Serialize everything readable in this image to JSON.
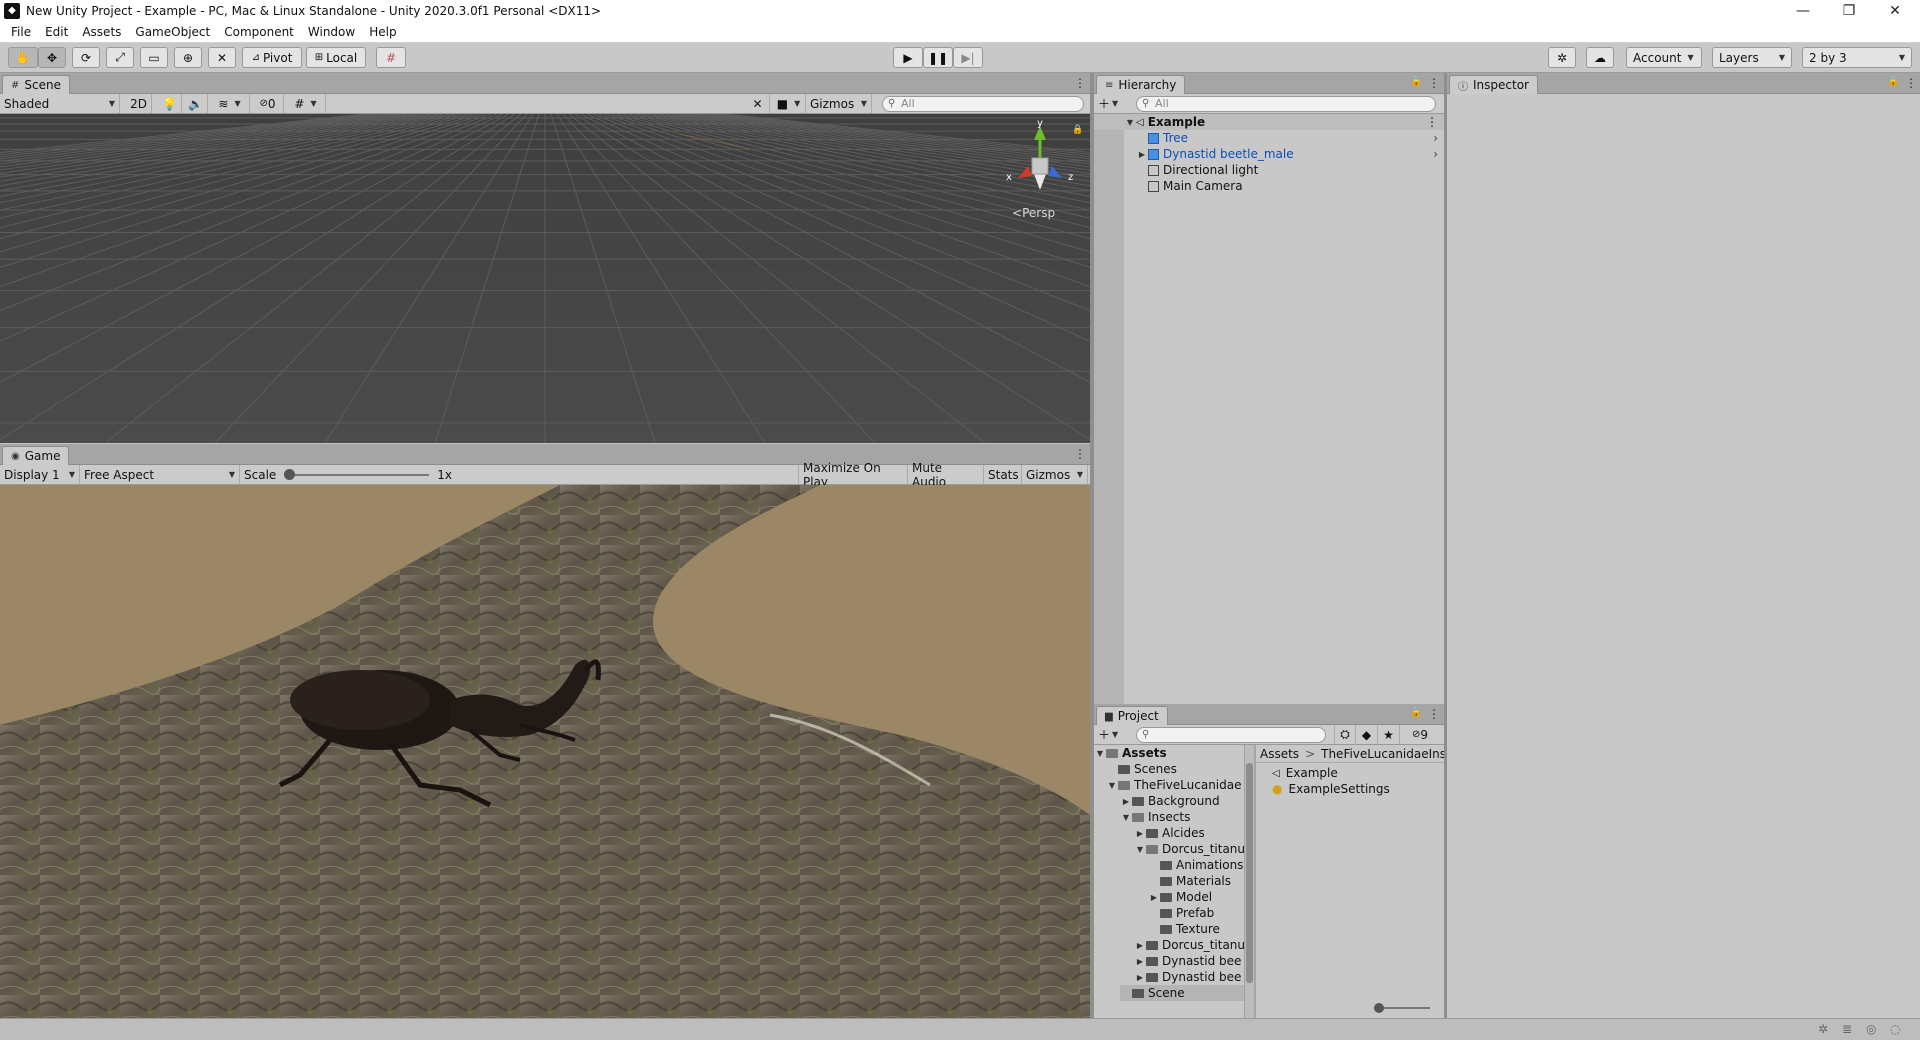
{
  "window": {
    "title": "New Unity Project - Example - PC, Mac & Linux Standalone - Unity 2020.3.0f1 Personal <DX11>",
    "minimize": "—",
    "maximize": "❐",
    "close": "✕"
  },
  "menu": [
    "File",
    "Edit",
    "Assets",
    "GameObject",
    "Component",
    "Window",
    "Help"
  ],
  "toolbar": {
    "pivot_label": "Pivot",
    "local_label": "Local",
    "account_label": "Account",
    "layers_label": "Layers",
    "layout_label": "2 by 3"
  },
  "scene": {
    "tab_label": "Scene",
    "shading_mode": "Shaded",
    "mode_2d": "2D",
    "hidden_count": "0",
    "gizmos_label": "Gizmos",
    "search_placeholder": "All",
    "persp_label": "Persp",
    "axis_x": "x",
    "axis_y": "y",
    "axis_z": "z"
  },
  "game": {
    "tab_label": "Game",
    "display": "Display 1",
    "aspect": "Free Aspect",
    "scale_label": "Scale",
    "scale_value": "1x",
    "scale_level": 0.0,
    "maximize_label": "Maximize On Play",
    "mute_label": "Mute Audio",
    "stats_label": "Stats",
    "gizmos_label": "Gizmos"
  },
  "hierarchy": {
    "tab_label": "Hierarchy",
    "search_placeholder": "All",
    "root": "Example",
    "items": [
      {
        "label": "Tree",
        "is_prefab": true,
        "expandable": false
      },
      {
        "label": "Dynastid beetle_male",
        "is_prefab": true,
        "expandable": true
      },
      {
        "label": "Directional light",
        "is_prefab": false,
        "expandable": false
      },
      {
        "label": "Main Camera",
        "is_prefab": false,
        "expandable": false
      }
    ]
  },
  "inspector": {
    "tab_label": "Inspector"
  },
  "project": {
    "tab_label": "Project",
    "hidden_count": "9",
    "breadcrumb_root": "Assets",
    "breadcrumb_sep": ">",
    "breadcrumb_current": "TheFiveLucanidaeInse",
    "tree": [
      {
        "label": "Assets",
        "bold": true
      },
      {
        "label": "Scenes"
      },
      {
        "label": "TheFiveLucanidae"
      },
      {
        "label": "Background"
      },
      {
        "label": "Insects"
      },
      {
        "label": "Alcides"
      },
      {
        "label": "Dorcus_titanu"
      },
      {
        "label": "Animations"
      },
      {
        "label": "Materials"
      },
      {
        "label": "Model"
      },
      {
        "label": "Prefab"
      },
      {
        "label": "Texture"
      },
      {
        "label": "Dorcus_titanu"
      },
      {
        "label": "Dynastid bee"
      },
      {
        "label": "Dynastid bee"
      },
      {
        "label": "Scene"
      }
    ],
    "files": [
      "Example",
      "ExampleSettings"
    ]
  },
  "colors": {
    "accent_blue": "#0b4fb5",
    "scene_bg": "#4a4a4a",
    "game_sky": "#9b8766",
    "panel_bg": "#c8c8c8"
  }
}
